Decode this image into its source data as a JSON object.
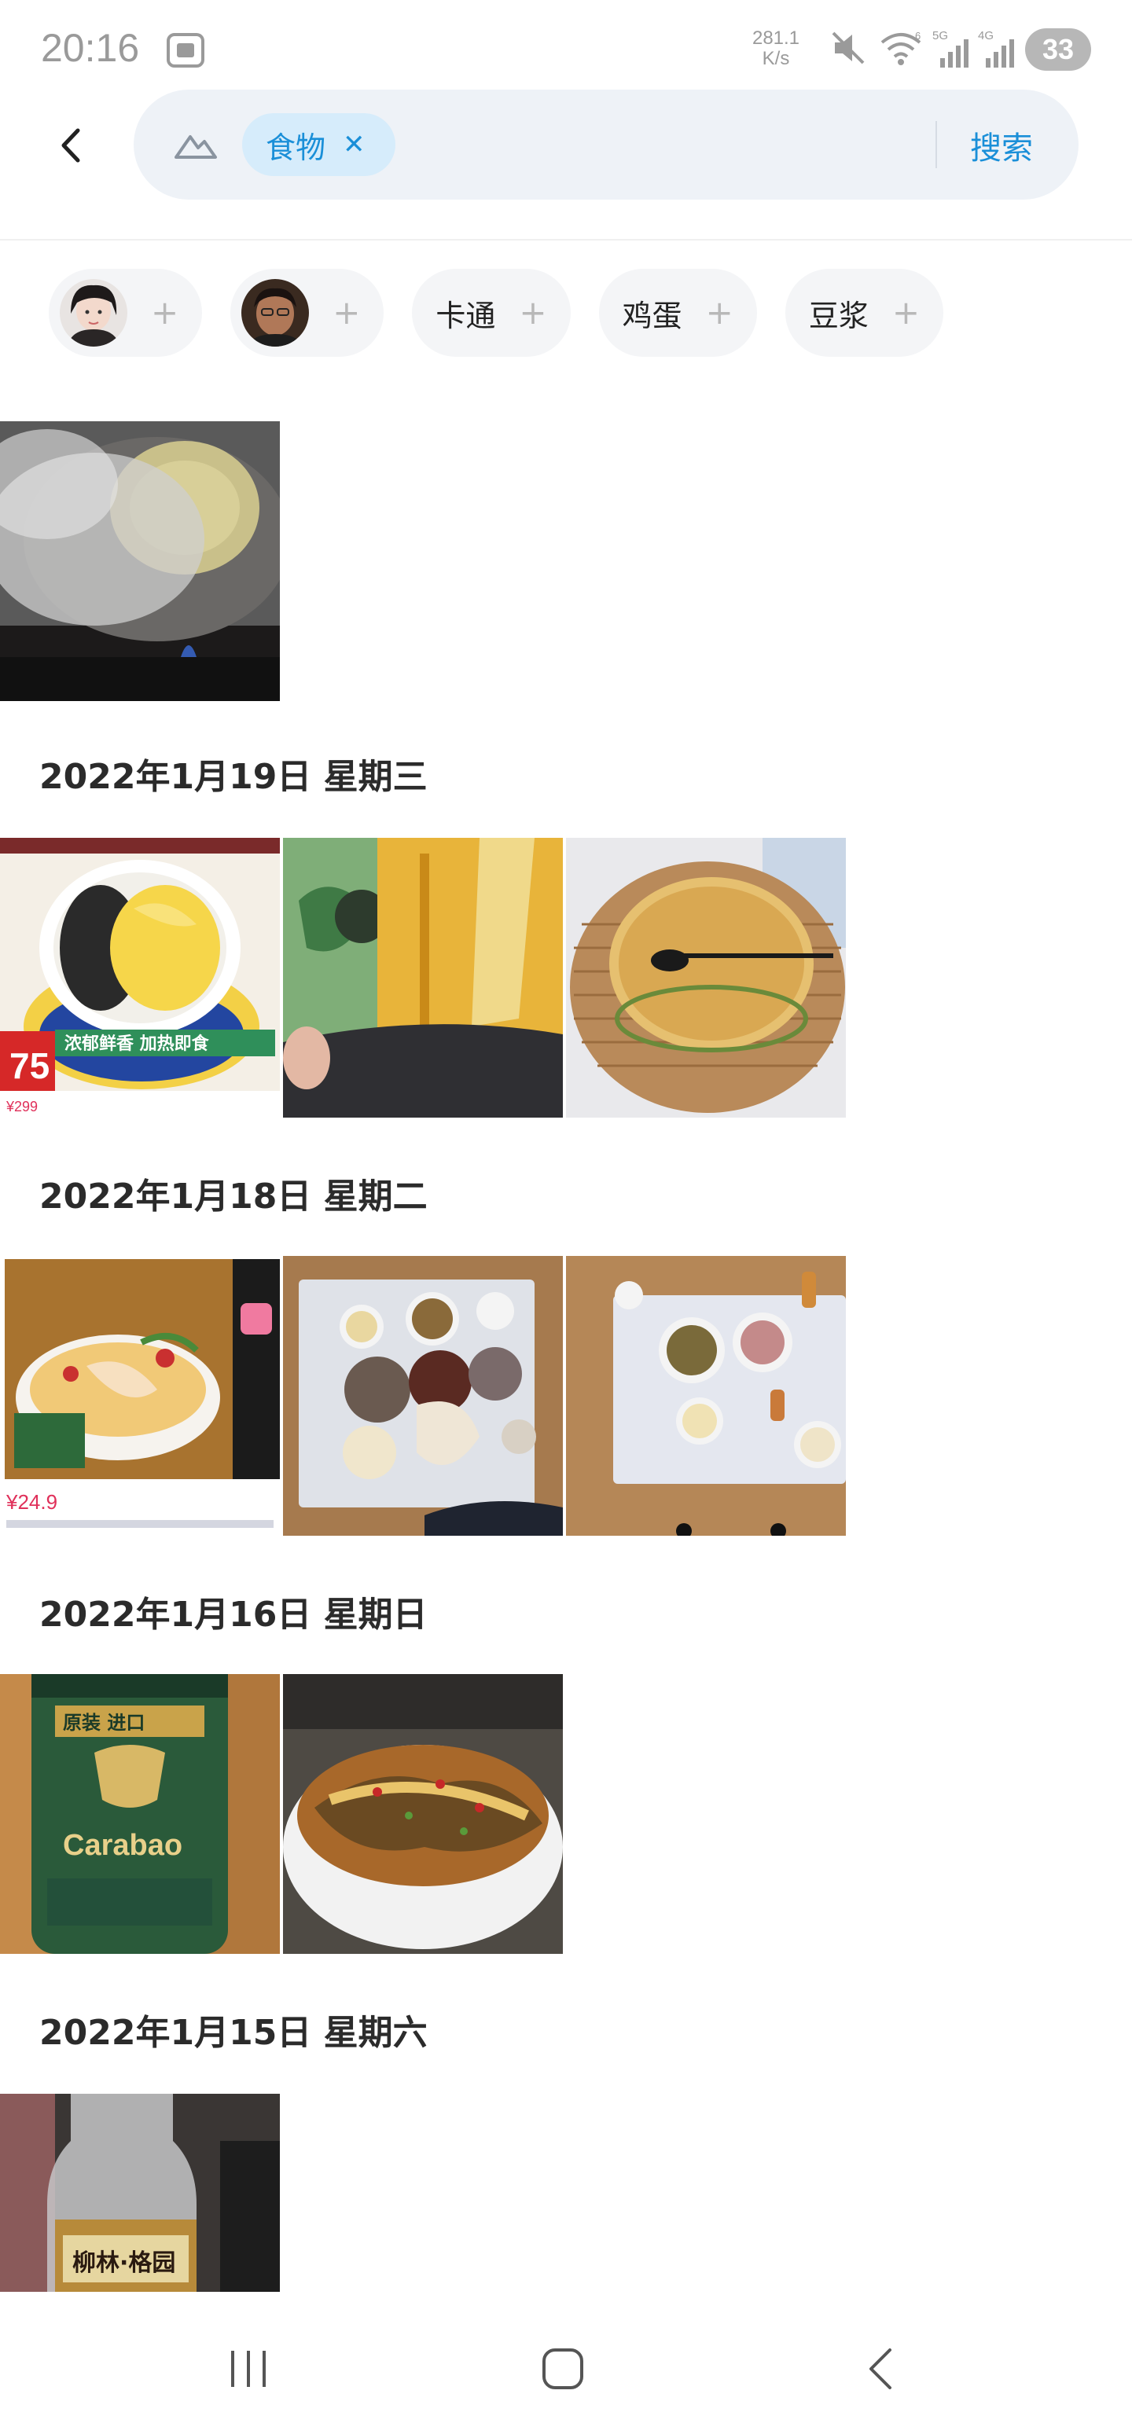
{
  "status_bar": {
    "time": "20:16",
    "net_speed_value": "281.1",
    "net_speed_unit": "K/s",
    "battery": "33",
    "icons": [
      "screenshot-icon",
      "mute-icon",
      "wifi-icon",
      "signal-5g-icon",
      "signal-4g-icon",
      "battery-icon"
    ]
  },
  "header": {
    "search_chip_label": "食物",
    "search_button_label": "搜索"
  },
  "suggestions": [
    {
      "type": "person",
      "label": ""
    },
    {
      "type": "person",
      "label": ""
    },
    {
      "type": "tag",
      "label": "卡通"
    },
    {
      "type": "tag",
      "label": "鸡蛋"
    },
    {
      "type": "tag",
      "label": "豆浆"
    }
  ],
  "sections": [
    {
      "date": "",
      "photos": [
        "food-photo-steaming-wok"
      ]
    },
    {
      "date": "2022年1月19日 星期三",
      "photos": [
        "food-photo-dumpling-bowl",
        "food-photo-snack-package",
        "food-photo-pancake"
      ],
      "photo_texts": {
        "price_big": "75",
        "price_small": "¥299",
        "banner": "浓郁鲜香 加热即食"
      }
    },
    {
      "date": "2022年1月18日 星期二",
      "photos": [
        "food-photo-noodle-ad",
        "food-photo-table-dishes",
        "food-photo-table-meal"
      ],
      "photo_texts": {
        "price": "¥24.9"
      }
    },
    {
      "date": "2022年1月16日 星期日",
      "photos": [
        "food-photo-carabao-can",
        "food-photo-fish-stew"
      ],
      "photo_texts": {
        "can_brand": "Carabao",
        "can_top": "原装 进口"
      }
    },
    {
      "date": "2022年1月15日 星期六",
      "photos": [
        "food-photo-beer-bottle"
      ],
      "photo_texts": {
        "label": "柳林·格园"
      }
    }
  ],
  "nav": [
    "recent-apps-icon",
    "home-icon",
    "back-icon"
  ],
  "colors": {
    "accent": "#1a8fd8",
    "chip_bg": "#d6ecfb",
    "search_bg": "#eef2f7"
  }
}
